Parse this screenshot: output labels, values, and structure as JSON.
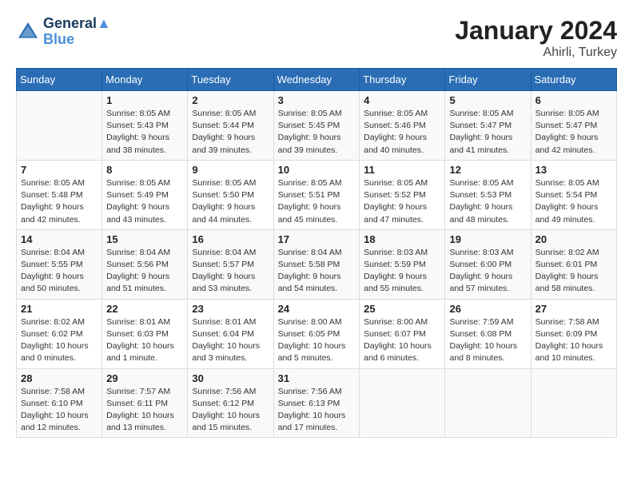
{
  "header": {
    "logo_line1": "General",
    "logo_line2": "Blue",
    "month": "January 2024",
    "location": "Ahirli, Turkey"
  },
  "weekdays": [
    "Sunday",
    "Monday",
    "Tuesday",
    "Wednesday",
    "Thursday",
    "Friday",
    "Saturday"
  ],
  "weeks": [
    [
      {
        "day": "",
        "info": ""
      },
      {
        "day": "1",
        "info": "Sunrise: 8:05 AM\nSunset: 5:43 PM\nDaylight: 9 hours\nand 38 minutes."
      },
      {
        "day": "2",
        "info": "Sunrise: 8:05 AM\nSunset: 5:44 PM\nDaylight: 9 hours\nand 39 minutes."
      },
      {
        "day": "3",
        "info": "Sunrise: 8:05 AM\nSunset: 5:45 PM\nDaylight: 9 hours\nand 39 minutes."
      },
      {
        "day": "4",
        "info": "Sunrise: 8:05 AM\nSunset: 5:46 PM\nDaylight: 9 hours\nand 40 minutes."
      },
      {
        "day": "5",
        "info": "Sunrise: 8:05 AM\nSunset: 5:47 PM\nDaylight: 9 hours\nand 41 minutes."
      },
      {
        "day": "6",
        "info": "Sunrise: 8:05 AM\nSunset: 5:47 PM\nDaylight: 9 hours\nand 42 minutes."
      }
    ],
    [
      {
        "day": "7",
        "info": "Sunrise: 8:05 AM\nSunset: 5:48 PM\nDaylight: 9 hours\nand 42 minutes."
      },
      {
        "day": "8",
        "info": "Sunrise: 8:05 AM\nSunset: 5:49 PM\nDaylight: 9 hours\nand 43 minutes."
      },
      {
        "day": "9",
        "info": "Sunrise: 8:05 AM\nSunset: 5:50 PM\nDaylight: 9 hours\nand 44 minutes."
      },
      {
        "day": "10",
        "info": "Sunrise: 8:05 AM\nSunset: 5:51 PM\nDaylight: 9 hours\nand 45 minutes."
      },
      {
        "day": "11",
        "info": "Sunrise: 8:05 AM\nSunset: 5:52 PM\nDaylight: 9 hours\nand 47 minutes."
      },
      {
        "day": "12",
        "info": "Sunrise: 8:05 AM\nSunset: 5:53 PM\nDaylight: 9 hours\nand 48 minutes."
      },
      {
        "day": "13",
        "info": "Sunrise: 8:05 AM\nSunset: 5:54 PM\nDaylight: 9 hours\nand 49 minutes."
      }
    ],
    [
      {
        "day": "14",
        "info": "Sunrise: 8:04 AM\nSunset: 5:55 PM\nDaylight: 9 hours\nand 50 minutes."
      },
      {
        "day": "15",
        "info": "Sunrise: 8:04 AM\nSunset: 5:56 PM\nDaylight: 9 hours\nand 51 minutes."
      },
      {
        "day": "16",
        "info": "Sunrise: 8:04 AM\nSunset: 5:57 PM\nDaylight: 9 hours\nand 53 minutes."
      },
      {
        "day": "17",
        "info": "Sunrise: 8:04 AM\nSunset: 5:58 PM\nDaylight: 9 hours\nand 54 minutes."
      },
      {
        "day": "18",
        "info": "Sunrise: 8:03 AM\nSunset: 5:59 PM\nDaylight: 9 hours\nand 55 minutes."
      },
      {
        "day": "19",
        "info": "Sunrise: 8:03 AM\nSunset: 6:00 PM\nDaylight: 9 hours\nand 57 minutes."
      },
      {
        "day": "20",
        "info": "Sunrise: 8:02 AM\nSunset: 6:01 PM\nDaylight: 9 hours\nand 58 minutes."
      }
    ],
    [
      {
        "day": "21",
        "info": "Sunrise: 8:02 AM\nSunset: 6:02 PM\nDaylight: 10 hours\nand 0 minutes."
      },
      {
        "day": "22",
        "info": "Sunrise: 8:01 AM\nSunset: 6:03 PM\nDaylight: 10 hours\nand 1 minute."
      },
      {
        "day": "23",
        "info": "Sunrise: 8:01 AM\nSunset: 6:04 PM\nDaylight: 10 hours\nand 3 minutes."
      },
      {
        "day": "24",
        "info": "Sunrise: 8:00 AM\nSunset: 6:05 PM\nDaylight: 10 hours\nand 5 minutes."
      },
      {
        "day": "25",
        "info": "Sunrise: 8:00 AM\nSunset: 6:07 PM\nDaylight: 10 hours\nand 6 minutes."
      },
      {
        "day": "26",
        "info": "Sunrise: 7:59 AM\nSunset: 6:08 PM\nDaylight: 10 hours\nand 8 minutes."
      },
      {
        "day": "27",
        "info": "Sunrise: 7:58 AM\nSunset: 6:09 PM\nDaylight: 10 hours\nand 10 minutes."
      }
    ],
    [
      {
        "day": "28",
        "info": "Sunrise: 7:58 AM\nSunset: 6:10 PM\nDaylight: 10 hours\nand 12 minutes."
      },
      {
        "day": "29",
        "info": "Sunrise: 7:57 AM\nSunset: 6:11 PM\nDaylight: 10 hours\nand 13 minutes."
      },
      {
        "day": "30",
        "info": "Sunrise: 7:56 AM\nSunset: 6:12 PM\nDaylight: 10 hours\nand 15 minutes."
      },
      {
        "day": "31",
        "info": "Sunrise: 7:56 AM\nSunset: 6:13 PM\nDaylight: 10 hours\nand 17 minutes."
      },
      {
        "day": "",
        "info": ""
      },
      {
        "day": "",
        "info": ""
      },
      {
        "day": "",
        "info": ""
      }
    ]
  ]
}
